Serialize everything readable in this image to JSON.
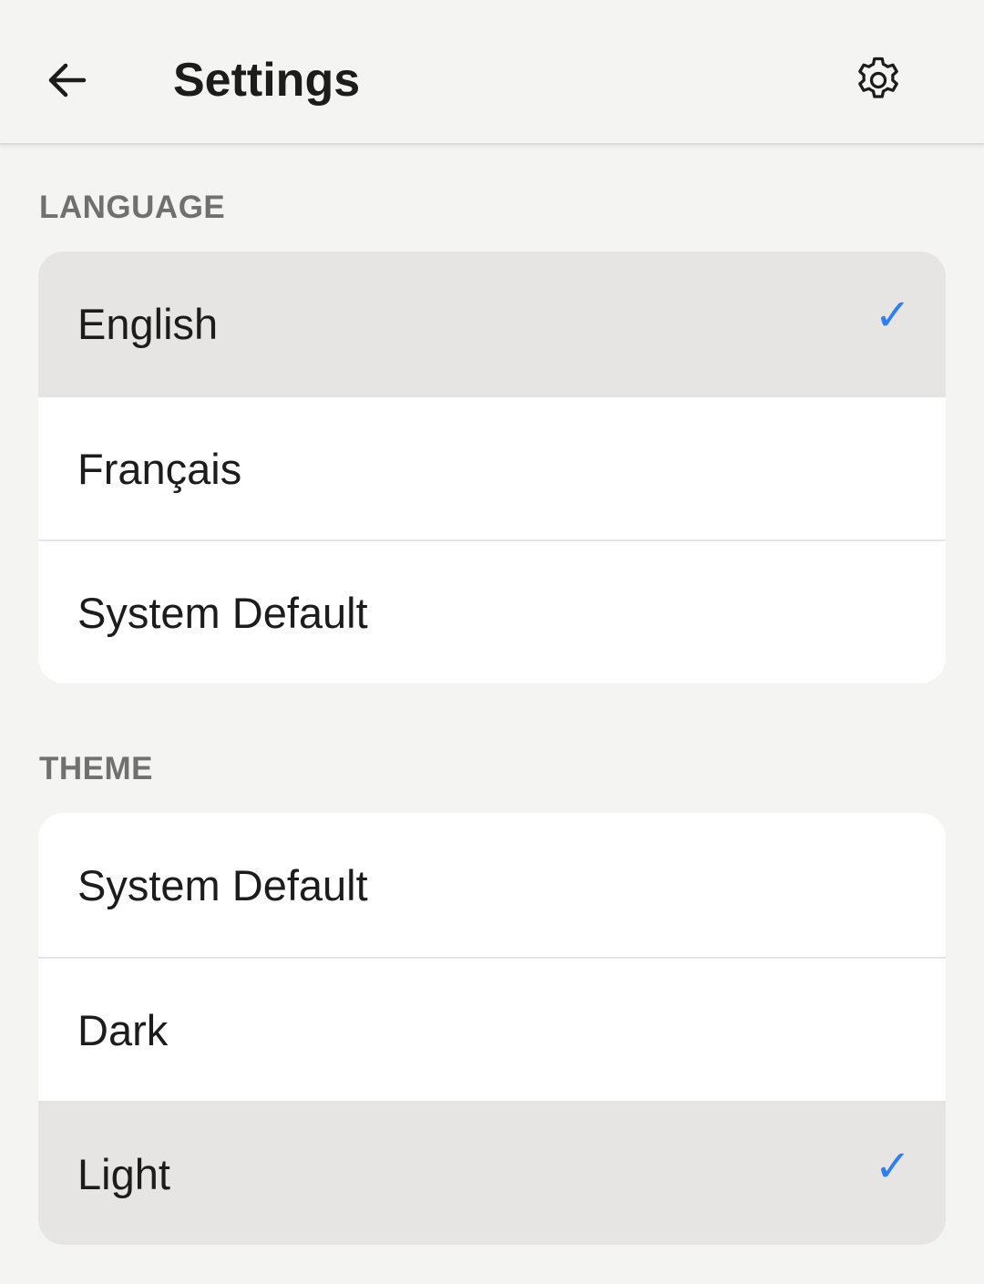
{
  "header": {
    "title": "Settings",
    "back_icon": "arrow-left-icon",
    "settings_icon": "gear-icon"
  },
  "language": {
    "label": "LANGUAGE",
    "options": [
      {
        "label": "English",
        "selected": true
      },
      {
        "label": "Français",
        "selected": false
      },
      {
        "label": "System Default",
        "selected": false
      }
    ]
  },
  "theme": {
    "label": "THEME",
    "options": [
      {
        "label": "System Default",
        "selected": false
      },
      {
        "label": "Dark",
        "selected": false
      },
      {
        "label": "Light",
        "selected": true
      }
    ]
  },
  "check_glyph": "✓",
  "colors": {
    "accent": "#2f7ff0",
    "selected_row": "#e6e5e3",
    "background": "#f4f4f3",
    "section_label": "#707070"
  }
}
